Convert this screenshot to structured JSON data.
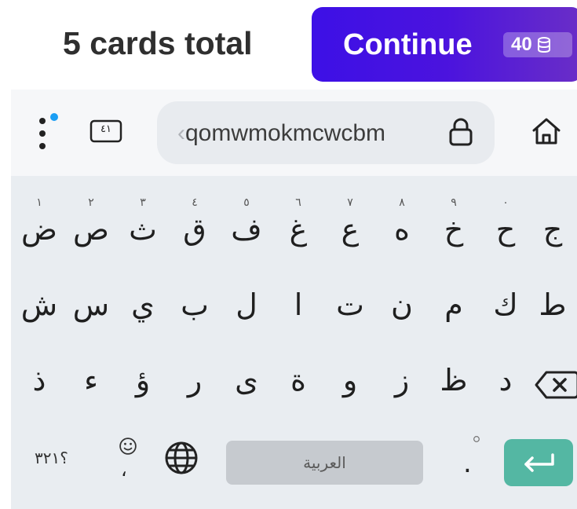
{
  "header": {
    "cards_total": "5 cards total",
    "continue_label": "Continue",
    "cost": "40",
    "accent_color": "#4b13de"
  },
  "toolbar": {
    "url_fade": "‹",
    "url_text": "qomwmokmcwcbm",
    "numkey_label": "٤١"
  },
  "keyboard": {
    "row1": [
      {
        "ch": "ض",
        "hint": "١"
      },
      {
        "ch": "ص",
        "hint": "٢"
      },
      {
        "ch": "ث",
        "hint": "٣"
      },
      {
        "ch": "ق",
        "hint": "٤"
      },
      {
        "ch": "ف",
        "hint": "٥"
      },
      {
        "ch": "غ",
        "hint": "٦"
      },
      {
        "ch": "ع",
        "hint": "٧"
      },
      {
        "ch": "ه",
        "hint": "٨"
      },
      {
        "ch": "خ",
        "hint": "٩"
      },
      {
        "ch": "ح",
        "hint": "٠"
      },
      {
        "ch": "ج",
        "hint": ""
      }
    ],
    "row2": [
      "ش",
      "س",
      "ي",
      "ب",
      "ل",
      "ا",
      "ت",
      "ن",
      "م",
      "ك",
      "ط"
    ],
    "row3": [
      "ذ",
      "ء",
      "ؤ",
      "ر",
      "ى",
      "ة",
      "و",
      "ز",
      "ظ",
      "د"
    ],
    "symbols_label": "؟٣٢١",
    "emoji_comma": "،",
    "space_label": "العربية",
    "period": ".",
    "icons": [
      "menu-icon",
      "numeric-keypad-icon",
      "lock-icon",
      "home-icon",
      "backspace-icon",
      "emoji-icon",
      "globe-icon",
      "enter-icon",
      "coin-icon"
    ]
  }
}
